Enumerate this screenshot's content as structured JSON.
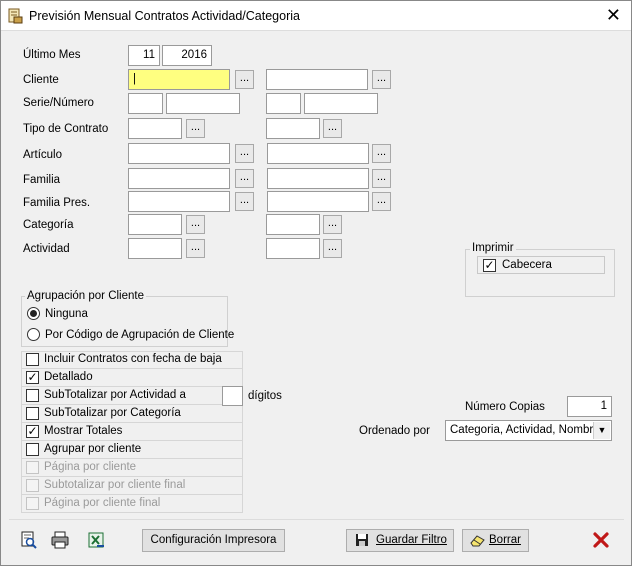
{
  "window": {
    "title": "Previsión Mensual Contratos Actividad/Categoria"
  },
  "filters": {
    "ultimo_mes": {
      "label": "Último Mes",
      "month": "11",
      "year": "2016"
    },
    "cliente": {
      "label": "Cliente",
      "from": "|",
      "to": ""
    },
    "serie_numero": {
      "label": "Serie/Número"
    },
    "tipo_contrato": {
      "label": "Tipo de Contrato"
    },
    "articulo": {
      "label": "Artículo"
    },
    "familia": {
      "label": "Familia"
    },
    "familia_pres": {
      "label": "Familia Pres."
    },
    "categoria": {
      "label": "Categoría"
    },
    "actividad": {
      "label": "Actividad"
    },
    "ellipsis": "..."
  },
  "imprimir": {
    "title": "Imprimir",
    "cabecera": {
      "label": "Cabecera",
      "checked": true
    }
  },
  "agrupacion": {
    "title": "Agrupación por Cliente",
    "options": [
      {
        "label": "Ninguna",
        "selected": true
      },
      {
        "label": "Por Código de Agrupación de Cliente",
        "selected": false
      }
    ]
  },
  "options": [
    {
      "label": "Incluir Contratos con fecha de baja",
      "checked": false,
      "enabled": true
    },
    {
      "label": "Detallado",
      "checked": true,
      "enabled": true
    },
    {
      "label": "SubTotalizar por Actividad a",
      "checked": false,
      "enabled": true
    },
    {
      "label": "SubTotalizar por Categoría",
      "checked": false,
      "enabled": true
    },
    {
      "label": "Mostrar Totales",
      "checked": true,
      "enabled": true
    },
    {
      "label": "Agrupar por cliente",
      "checked": false,
      "enabled": true
    },
    {
      "label": "Página por cliente",
      "checked": false,
      "enabled": false
    },
    {
      "label": "Subtotalizar por cliente final",
      "checked": false,
      "enabled": false
    },
    {
      "label": "Página por cliente final",
      "checked": false,
      "enabled": false
    }
  ],
  "digitos": {
    "label": "dígitos",
    "value": ""
  },
  "copias": {
    "label": "Número Copias",
    "value": "1"
  },
  "ordenado": {
    "label": "Ordenado por",
    "value": "Categoria, Actividad, Nombre"
  },
  "buttons": {
    "config": "Configuración Impresora",
    "guardar": "Guardar Filtro",
    "borrar": "Borrar"
  },
  "icons": {
    "title": "report-icon",
    "preview": "print-preview-icon",
    "print": "printer-icon",
    "excel": "excel-export-icon",
    "save": "floppy-disk-icon",
    "eraser": "eraser-icon",
    "cancel": "red-x-icon"
  }
}
